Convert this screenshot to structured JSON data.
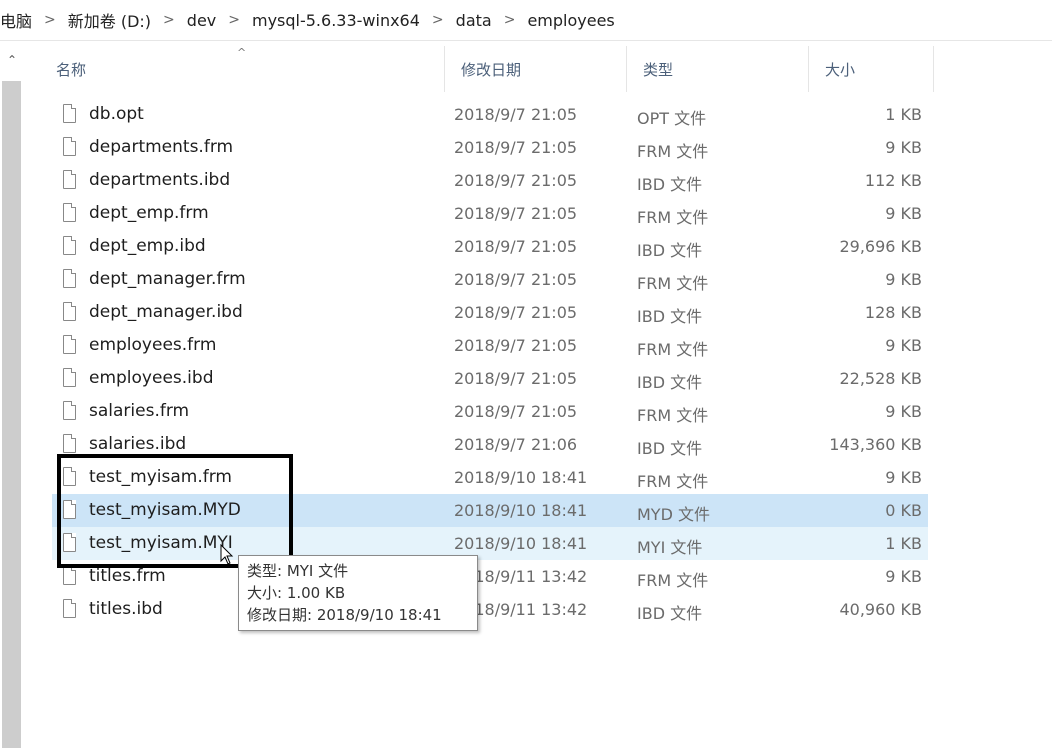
{
  "breadcrumb": [
    "电脑",
    "新加卷 (D:)",
    "dev",
    "mysql-5.6.33-winx64",
    "data",
    "employees"
  ],
  "columns": {
    "name": "名称",
    "date": "修改日期",
    "type": "类型",
    "size": "大小"
  },
  "files": [
    {
      "name": "db.opt",
      "date": "2018/9/7 21:05",
      "type": "OPT 文件",
      "size": "1 KB"
    },
    {
      "name": "departments.frm",
      "date": "2018/9/7 21:05",
      "type": "FRM 文件",
      "size": "9 KB"
    },
    {
      "name": "departments.ibd",
      "date": "2018/9/7 21:05",
      "type": "IBD 文件",
      "size": "112 KB"
    },
    {
      "name": "dept_emp.frm",
      "date": "2018/9/7 21:05",
      "type": "FRM 文件",
      "size": "9 KB"
    },
    {
      "name": "dept_emp.ibd",
      "date": "2018/9/7 21:05",
      "type": "IBD 文件",
      "size": "29,696 KB"
    },
    {
      "name": "dept_manager.frm",
      "date": "2018/9/7 21:05",
      "type": "FRM 文件",
      "size": "9 KB"
    },
    {
      "name": "dept_manager.ibd",
      "date": "2018/9/7 21:05",
      "type": "IBD 文件",
      "size": "128 KB"
    },
    {
      "name": "employees.frm",
      "date": "2018/9/7 21:05",
      "type": "FRM 文件",
      "size": "9 KB"
    },
    {
      "name": "employees.ibd",
      "date": "2018/9/7 21:05",
      "type": "IBD 文件",
      "size": "22,528 KB"
    },
    {
      "name": "salaries.frm",
      "date": "2018/9/7 21:05",
      "type": "FRM 文件",
      "size": "9 KB"
    },
    {
      "name": "salaries.ibd",
      "date": "2018/9/7 21:06",
      "type": "IBD 文件",
      "size": "143,360 KB"
    },
    {
      "name": "test_myisam.frm",
      "date": "2018/9/10 18:41",
      "type": "FRM 文件",
      "size": "9 KB"
    },
    {
      "name": "test_myisam.MYD",
      "date": "2018/9/10 18:41",
      "type": "MYD 文件",
      "size": "0 KB"
    },
    {
      "name": "test_myisam.MYI",
      "date": "2018/9/10 18:41",
      "type": "MYI 文件",
      "size": "1 KB"
    },
    {
      "name": "titles.frm",
      "date": "2018/9/11 13:42",
      "type": "FRM 文件",
      "size": "9 KB"
    },
    {
      "name": "titles.ibd",
      "date": "2018/9/11 13:42",
      "type": "IBD 文件",
      "size": "40,960 KB"
    }
  ],
  "selected_file": "test_myisam.MYD",
  "hovered_file": "test_myisam.MYI",
  "tooltip": {
    "type_line": "类型: MYI 文件",
    "size_line": "大小: 1.00 KB",
    "date_line": "修改日期: 2018/9/10 18:41"
  },
  "colors": {
    "selected_row": "#cce4f7",
    "hover_row": "#e5f3fb",
    "header_text": "#4c607a"
  },
  "icons": {
    "file": "file-icon",
    "sort": "sort-ascending-icon",
    "scroll_up": "scroll-up-arrow-icon"
  }
}
